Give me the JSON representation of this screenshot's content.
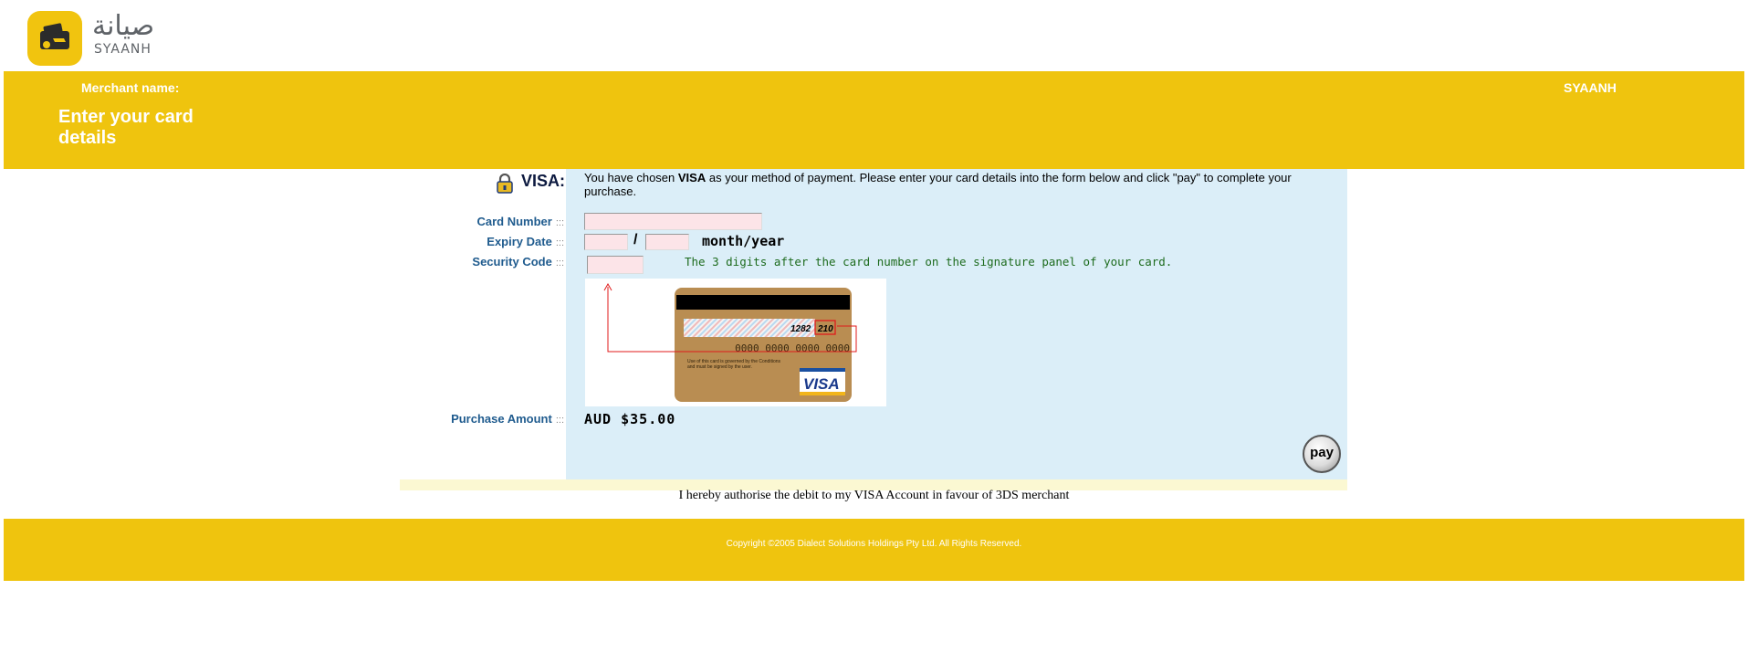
{
  "brand": {
    "arabic": "صيانة",
    "latin": "SYAANH",
    "icon": "wallet-icon"
  },
  "header": {
    "merchant_label": "Merchant name:",
    "merchant_name": "SYAANH",
    "title": "Enter your card details"
  },
  "form": {
    "lock_icon": "lock-icon",
    "card_type": "VISA:",
    "intro_prefix": "You have chosen ",
    "intro_bold": "VISA",
    "intro_suffix": " as your method of payment. Please enter your card details into the form below and click \"pay\" to complete your purchase.",
    "card_number_label": "Card Number",
    "card_number_value": "",
    "expiry_label": "Expiry Date",
    "expiry_month_value": "",
    "expiry_year_value": "",
    "expiry_separator": "/",
    "expiry_hint": "month/year",
    "security_label": "Security Code",
    "security_value": "",
    "security_hint": "The 3 digits after the card number on the signature panel of your card.",
    "field_separator": ":::",
    "purchase_amount_label": "Purchase Amount",
    "purchase_amount_value": "AUD $35.00",
    "pay_label": "pay"
  },
  "card_image": {
    "signature_digits": "1282",
    "cvv_digits": "210",
    "embossed_number": "0000 0000 0000 0000",
    "small_text_line1": "Use of this card is governed by the Conditions",
    "small_text_line2": "and must be signed by the user.",
    "brand": "VISA"
  },
  "authorise_text": "I hereby authorise the debit to my VISA Account in favour of 3DS merchant",
  "footer": {
    "copyright": "Copyright ©2005 Dialect Solutions Holdings Pty Ltd. All Rights Reserved."
  },
  "colors": {
    "brand_yellow": "#efc40e",
    "panel_blue": "#dbeef8",
    "label_blue": "#1f5b8e",
    "input_pink": "#fce4e8",
    "hint_green": "#1d6b1d",
    "arrow_red": "#e01b1b"
  }
}
